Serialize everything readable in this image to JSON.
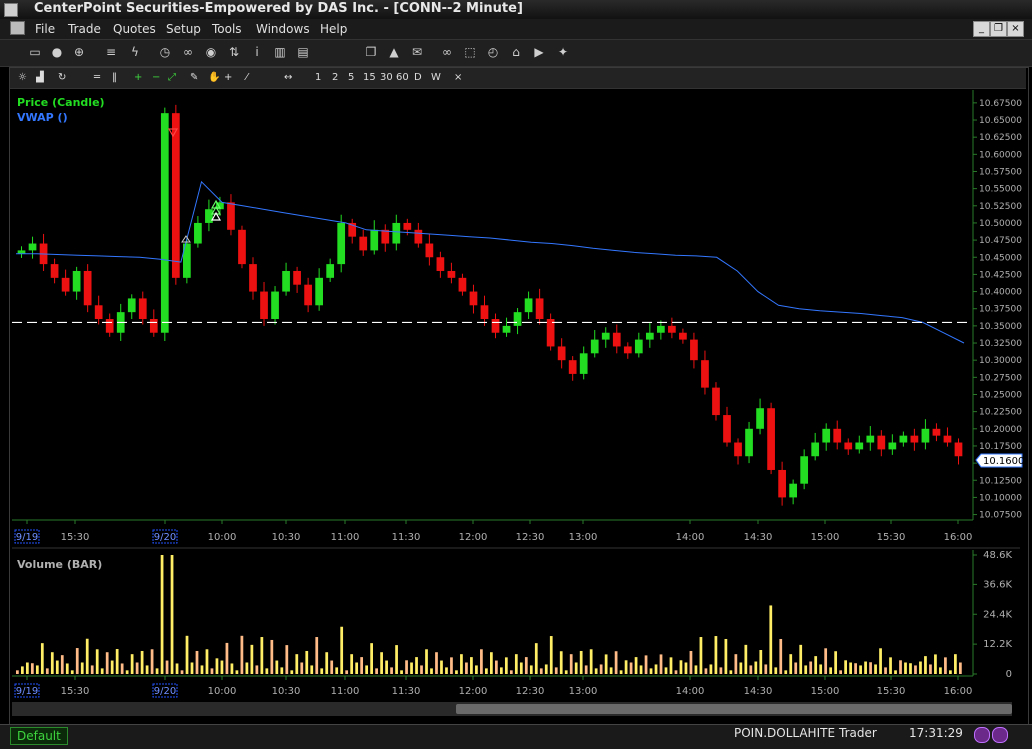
{
  "window": {
    "title": "CenterPoint Securities-Empowered by DAS Inc. - [CONN--2 Minute]"
  },
  "menu": [
    "File",
    "Trade",
    "Quotes",
    "Setup",
    "Tools",
    "Windows",
    "Help"
  ],
  "chart_toolbar": {
    "intervals": [
      "1",
      "2",
      "5",
      "15",
      "30",
      "60",
      "D",
      "W"
    ],
    "close": "×"
  },
  "legend": {
    "price": "Price (Candle)",
    "vwap": "VWAP ()",
    "volume": "Volume (BAR)"
  },
  "colors": {
    "up": "#22dd22",
    "down": "#ee1111",
    "vwap": "#3377ff",
    "volume_bar": "#ffee66",
    "volume_bar_alt": "#ffbb88",
    "axis_text": "#b0b0b0",
    "grid_axis": "#2a7a2a"
  },
  "chart_data": [
    {
      "type": "candlestick",
      "symbol": "CONN",
      "interval": "2 Minute",
      "y_ticks": [
        "10.67500",
        "10.65000",
        "10.62500",
        "10.60000",
        "10.57500",
        "10.55000",
        "10.52500",
        "10.50000",
        "10.47500",
        "10.45000",
        "10.42500",
        "10.40000",
        "10.37500",
        "10.35000",
        "10.32500",
        "10.30000",
        "10.27500",
        "10.25000",
        "10.22500",
        "10.20000",
        "10.17500",
        "10.15000",
        "10.12500",
        "10.10000",
        "10.07500"
      ],
      "ylim": [
        10.07,
        10.685
      ],
      "last_price": "10.1600",
      "reference_line": 10.355,
      "x_ticks": [
        "9/19",
        "15:30",
        "9/20",
        "10:00",
        "10:30",
        "11:00",
        "11:30",
        "12:00",
        "12:30",
        "13:00",
        "14:00",
        "14:30",
        "15:00",
        "15:30",
        "16:00"
      ],
      "series": [
        {
          "name": "Price (Candle)",
          "closes": [
            10.46,
            10.47,
            10.44,
            10.42,
            10.4,
            10.43,
            10.38,
            10.36,
            10.34,
            10.37,
            10.39,
            10.36,
            10.34,
            10.66,
            10.42,
            10.47,
            10.5,
            10.52,
            10.53,
            10.49,
            10.44,
            10.4,
            10.36,
            10.4,
            10.43,
            10.41,
            10.38,
            10.42,
            10.44,
            10.5,
            10.48,
            10.46,
            10.49,
            10.47,
            10.5,
            10.49,
            10.47,
            10.45,
            10.43,
            10.42,
            10.4,
            10.38,
            10.36,
            10.34,
            10.35,
            10.37,
            10.39,
            10.36,
            10.32,
            10.3,
            10.28,
            10.31,
            10.33,
            10.34,
            10.32,
            10.31,
            10.33,
            10.34,
            10.35,
            10.34,
            10.33,
            10.3,
            10.26,
            10.22,
            10.18,
            10.16,
            10.2,
            10.23,
            10.14,
            10.1,
            10.12,
            10.16,
            10.18,
            10.2,
            10.18,
            10.17,
            10.18,
            10.19,
            10.17,
            10.18,
            10.19,
            10.18,
            10.2,
            10.19,
            10.18,
            10.16
          ]
        },
        {
          "name": "VWAP ()",
          "values": [
            10.455,
            10.455,
            10.454,
            10.453,
            10.452,
            10.451,
            10.45,
            10.447,
            10.443,
            10.56,
            10.53,
            10.525,
            10.52,
            10.515,
            10.51,
            10.505,
            10.5,
            10.49,
            10.488,
            10.486,
            10.484,
            10.482,
            10.48,
            10.478,
            10.475,
            10.472,
            10.47,
            10.467,
            10.463,
            10.46,
            10.457,
            10.455,
            10.453,
            10.452,
            10.45,
            10.43,
            10.4,
            10.38,
            10.375,
            10.372,
            10.37,
            10.368,
            10.365,
            10.362,
            10.355,
            10.34,
            10.325
          ]
        }
      ]
    },
    {
      "type": "bar",
      "name": "Volume (BAR)",
      "y_ticks": [
        "48.6K",
        "36.6K",
        "24.4K",
        "12.2K",
        "0"
      ],
      "ylim": [
        0,
        48600
      ],
      "x_ticks": [
        "9/19",
        "15:30",
        "9/20",
        "10:00",
        "10:30",
        "11:00",
        "11:30",
        "12:00",
        "12:30",
        "13:00",
        "14:00",
        "14:30",
        "15:00",
        "15:30",
        "16:00"
      ]
    }
  ],
  "status": {
    "tab": "Default",
    "user": "POIN.DOLLAHITE",
    "role": "Trader",
    "time": "17:31:29"
  }
}
